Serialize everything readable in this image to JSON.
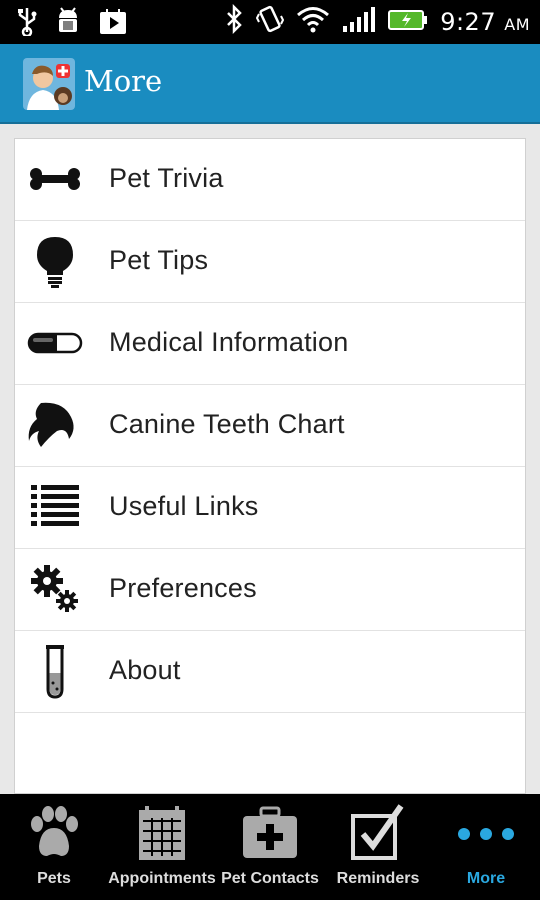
{
  "status_bar": {
    "time": "9:27",
    "ampm": "AM",
    "icons": [
      "usb-icon",
      "android-debug-icon",
      "play-store-icon",
      "bluetooth-icon",
      "vibrate-icon",
      "wifi-icon",
      "signal-icon",
      "battery-icon"
    ]
  },
  "action_bar": {
    "title": "More"
  },
  "menu": {
    "items": [
      {
        "label": "Pet Trivia",
        "icon": "bone-icon"
      },
      {
        "label": "Pet Tips",
        "icon": "lightbulb-icon"
      },
      {
        "label": "Medical Information",
        "icon": "pill-icon"
      },
      {
        "label": "Canine Teeth Chart",
        "icon": "tooth-icon"
      },
      {
        "label": "Useful Links",
        "icon": "list-icon"
      },
      {
        "label": "Preferences",
        "icon": "gears-icon"
      },
      {
        "label": "About",
        "icon": "test-tube-icon"
      }
    ]
  },
  "bottom_nav": {
    "tabs": [
      {
        "label": "Pets",
        "icon": "paw-icon"
      },
      {
        "label": "Appointments",
        "icon": "calendar-icon"
      },
      {
        "label": "Pet Contacts",
        "icon": "medkit-icon"
      },
      {
        "label": "Reminders",
        "icon": "checkbox-icon"
      },
      {
        "label": "More",
        "icon": "dots-icon"
      }
    ],
    "active": "More"
  },
  "colors": {
    "action_bar": "#1a8cc0",
    "active_tab": "#2aa8e0"
  }
}
